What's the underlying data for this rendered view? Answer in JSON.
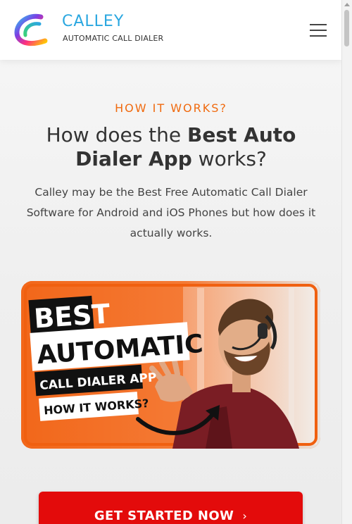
{
  "header": {
    "brand_name": "CALLEY",
    "tagline": "AUTOMATIC CALL DIALER",
    "logo_icon": "calley-logo-icon",
    "menu_icon": "hamburger-menu-icon"
  },
  "section": {
    "eyebrow": "HOW IT WORKS?",
    "headline_part1": "How does the ",
    "headline_bold": "Best Auto Dialer App",
    "headline_part2": " works?",
    "lead": "Calley may be the Best Free Automatic Call Dialer Software for Android and iOS Phones but how does it actually works."
  },
  "hero": {
    "line1": "BEST",
    "line2": "AUTOMATIC",
    "line3": "CALL DIALER APP",
    "line4": "HOW IT WORKS?",
    "accent_color": "#f36a18"
  },
  "cta": {
    "label": "GET STARTED NOW",
    "chevron": "›",
    "color": "#e30b0b"
  },
  "colors": {
    "brand": "#2aa7e0",
    "accent": "#f06a0f",
    "text": "#333333"
  }
}
